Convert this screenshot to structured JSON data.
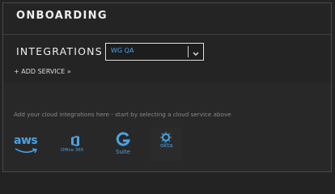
{
  "header": {
    "title": "ONBOARDING"
  },
  "integrations": {
    "label": "INTEGRATIONS",
    "selected_value": "WG QA",
    "add_service_label": "+ ADD SERVICE »"
  },
  "hint": {
    "text": "Add your cloud integrations here - start by selecting a cloud service above"
  },
  "services": {
    "aws": {
      "label": "aws",
      "icon": "aws-logo-icon"
    },
    "office365": {
      "label": "Office 365",
      "icon": "office365-logo-icon"
    },
    "gsuite": {
      "label": "Suite",
      "icon": "g-suite-logo-icon"
    },
    "okta": {
      "label": "okta",
      "icon": "okta-logo-icon"
    }
  },
  "colors": {
    "accent": "#4aa3e6",
    "background": "#242424",
    "border": "#4a4a4a"
  }
}
